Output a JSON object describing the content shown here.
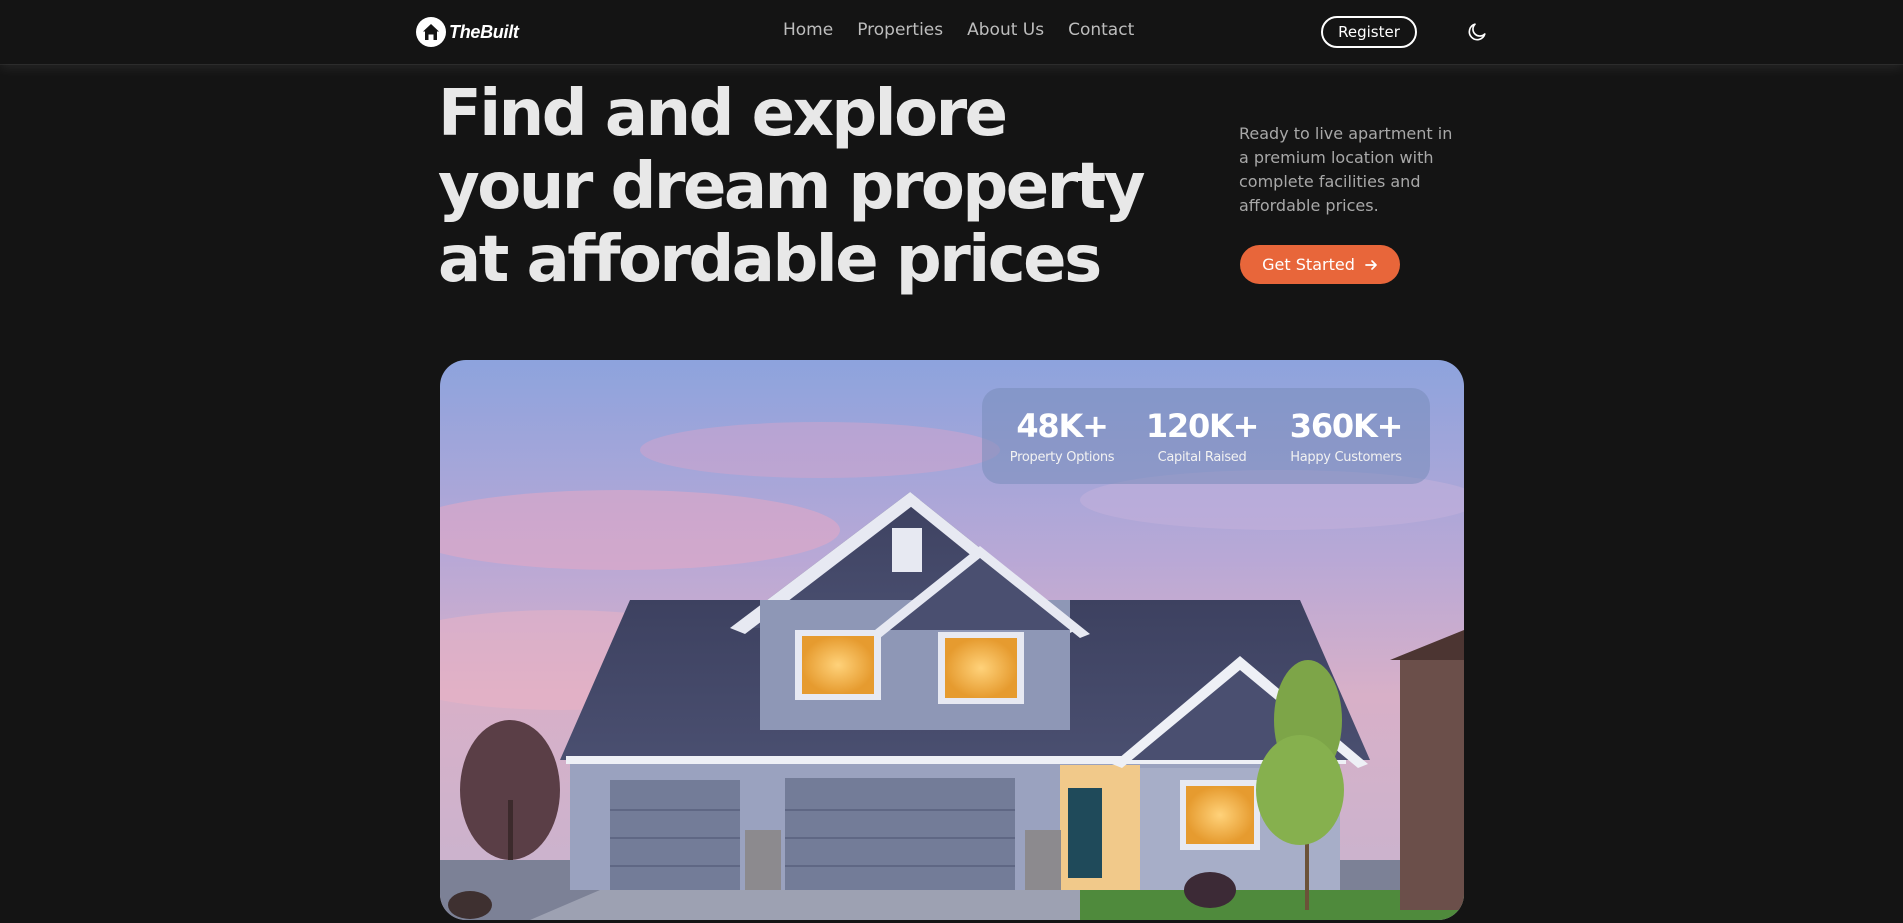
{
  "nav": {
    "brand": "TheBuilt",
    "links": [
      {
        "label": "Home"
      },
      {
        "label": "Properties"
      },
      {
        "label": "About Us"
      },
      {
        "label": "Contact"
      }
    ],
    "register_label": "Register",
    "theme_icon": "moon-icon"
  },
  "hero": {
    "title": "Find and explore your dream property at affordable prices",
    "description": "Ready to live apartment in a premium location with complete facilities and affordable prices.",
    "cta_label": "Get Started",
    "cta_icon": "arrow-right-icon"
  },
  "stats": [
    {
      "value": "48K+",
      "label": "Property Options"
    },
    {
      "value": "120K+",
      "label": "Capital Raised"
    },
    {
      "value": "360K+",
      "label": "Happy Customers"
    }
  ],
  "colors": {
    "background": "#141414",
    "accent": "#e8663a",
    "text": "#e8e8e8",
    "muted": "#a8a8a8"
  }
}
